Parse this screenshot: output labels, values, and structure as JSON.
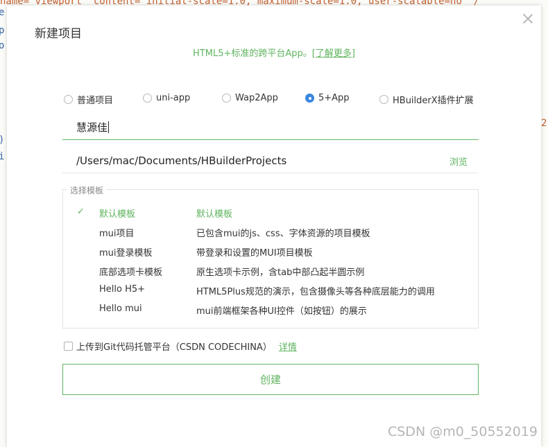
{
  "background": {
    "code_line": "name=\"viewport\" content=\"initial-scale=1.0, maximum-scale=1.0, user-scalable=no\" /",
    "gutter": [
      "e",
      "p",
      "o",
      ")",
      "i"
    ],
    "right_char": "2\""
  },
  "dialog": {
    "title": "新建项目",
    "subtitle_text": "HTML5+标准的跨平台App。",
    "subtitle_link": "[了解更多]",
    "project_types": [
      {
        "label": "普通项目",
        "checked": false
      },
      {
        "label": "uni-app",
        "checked": false
      },
      {
        "label": "Wap2App",
        "checked": false
      },
      {
        "label": "5+App",
        "checked": true
      },
      {
        "label": "HBuilderX插件扩展",
        "checked": false
      }
    ],
    "project_name": "慧源佳",
    "project_path": "/Users/mac/Documents/HBuilderProjects",
    "browse_label": "浏览",
    "template_legend": "选择模板",
    "templates": [
      {
        "name": "默认模板",
        "desc": "默认模板",
        "selected": true
      },
      {
        "name": "mui项目",
        "desc": "已包含mui的js、css、字体资源的项目模板",
        "selected": false
      },
      {
        "name": "mui登录模板",
        "desc": "带登录和设置的MUI项目模板",
        "selected": false
      },
      {
        "name": "底部选项卡模板",
        "desc": "原生选项卡示例，含tab中部凸起半圆示例",
        "selected": false
      },
      {
        "name": "Hello H5+",
        "desc": "HTML5Plus规范的演示，包含摄像头等各种底层能力的调用",
        "selected": false
      },
      {
        "name": "Hello mui",
        "desc": "mui前端框架各种UI控件（如按钮）的展示",
        "selected": false
      }
    ],
    "check_mark": "✓",
    "upload_label": "上传到Git代码托管平台（CSDN CODECHINA）",
    "upload_details": "详情",
    "create_label": "创建"
  },
  "watermark": "CSDN @m0_50552019",
  "colors": {
    "accent_green": "#5fb45f",
    "radio_blue": "#3a86e0"
  }
}
